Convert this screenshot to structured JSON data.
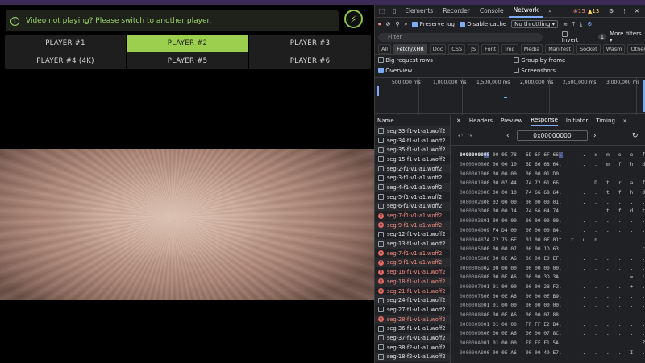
{
  "notice": {
    "text": "Video not playing? Please switch to another player.",
    "icon": "info-icon"
  },
  "players": [
    "PLAYER #1",
    "PLAYER #2",
    "PLAYER #3",
    "PLAYER #4 (4K)",
    "PLAYER #5",
    "PLAYER #6"
  ],
  "active_player": 1,
  "devtools": {
    "tabs": [
      "Elements",
      "Recorder",
      "Console",
      "Network"
    ],
    "active_tab": "Network",
    "errors": "15",
    "warnings": "13",
    "preserve_log": "Preserve log",
    "disable_cache": "Disable cache",
    "throttling": "No throttling",
    "filter_placeholder": "Filter",
    "invert": "Invert",
    "more_filters": "More filters",
    "more_filters_count": "1",
    "types": [
      "All",
      "Fetch/XHR",
      "Doc",
      "CSS",
      "JS",
      "Font",
      "Img",
      "Media",
      "Manifest",
      "Socket",
      "Wasm",
      "Other"
    ],
    "active_type": "Fetch/XHR",
    "opts": {
      "big": "Big request rows",
      "group": "Group by frame",
      "overview": "Overview",
      "screenshots": "Screenshots"
    },
    "timeline": [
      "500,000 ms",
      "1,000,000 ms",
      "1,500,000 ms",
      "2,000,000 ms",
      "2,500,000 ms",
      "3,000,000 ms"
    ],
    "name_header": "Name",
    "detail_tabs": [
      "Headers",
      "Preview",
      "Response",
      "Initiator",
      "Timing"
    ],
    "active_detail": "Response",
    "offset": "0x00000000",
    "requests": [
      {
        "n": "seg-33-f1-v1-a1.woff2",
        "e": false
      },
      {
        "n": "seg-34-f1-v1-a1.woff2",
        "e": false
      },
      {
        "n": "seg-35-f1-v1-a1.woff2",
        "e": false
      },
      {
        "n": "seg-15-f1-v1-a1.woff2",
        "e": false
      },
      {
        "n": "seg-2-f1-v1-a1.woff2",
        "e": false
      },
      {
        "n": "seg-3-f1-v1-a1.woff2",
        "e": false
      },
      {
        "n": "seg-4-f1-v1-a1.woff2",
        "e": false
      },
      {
        "n": "seg-5-f1-v1-a1.woff2",
        "e": false
      },
      {
        "n": "seg-6-f1-v1-a1.woff2",
        "e": false
      },
      {
        "n": "seg-7-f1-v1-a1.woff2",
        "e": true
      },
      {
        "n": "seg-9-f1-v1-a1.woff2",
        "e": true
      },
      {
        "n": "seg-12-f1-v1-a1.woff2",
        "e": false
      },
      {
        "n": "seg-13-f1-v1-a1.woff2",
        "e": false
      },
      {
        "n": "seg-7-f1-v1-a1.woff2",
        "e": true
      },
      {
        "n": "seg-9-f1-v1-a1.woff2",
        "e": true
      },
      {
        "n": "seg-16-f1-v1-a1.woff2",
        "e": true
      },
      {
        "n": "seg-18-f1-v1-a1.woff2",
        "e": true
      },
      {
        "n": "seg-21-f1-v1-a1.woff2",
        "e": true
      },
      {
        "n": "seg-24-f1-v1-a1.woff2",
        "e": false
      },
      {
        "n": "seg-27-f1-v1-a1.woff2",
        "e": false
      },
      {
        "n": "seg-28-f1-v1-a1.woff2",
        "e": true
      },
      {
        "n": "seg-36-f1-v1-a1.woff2",
        "e": false
      },
      {
        "n": "seg-37-f1-v1-a1.woff2",
        "e": false
      },
      {
        "n": "seg-38-f2-v1-a1.woff2",
        "e": false
      },
      {
        "n": "seg-18-f2-v1-a1.woff2",
        "e": false
      }
    ],
    "hex": [
      [
        "00000000",
        "00 00 0E 78   6D 6F 6F 66",
        ".  .  .  x  m  o  o  f"
      ],
      [
        "00000008",
        "00 00 00 10   6D 66 68 64",
        ".  .  .  .  m  f  h  d"
      ],
      [
        "00000010",
        "00 00 00 00   00 00 01 D0",
        ".  .  .  .  .  .  .  ."
      ],
      [
        "00000018",
        "00 00 07 44   74 72 61 66",
        ".  .  .  D  t  r  a  f"
      ],
      [
        "00000020",
        "00 00 00 10   74 66 68 64",
        ".  .  .  .  t  f  h  d"
      ],
      [
        "00000028",
        "00 02 00 00   00 00 00 01",
        ".  .  .  .  .  .  .  ."
      ],
      [
        "00000030",
        "00 00 00 14   74 66 64 74",
        ".  .  .  .  t  f  d  t"
      ],
      [
        "00000038",
        "01 00 00 00   00 00 00 00",
        ".  .  .  .  .  .  .  ."
      ],
      [
        "00000040",
        "09 F4 D4 00   00 00 00 84",
        ".  .  .  .  .  .  .  ."
      ],
      [
        "00000048",
        "74 72 75 6E   01 00 0F 01",
        "t  r  u  n  .  .  .  ."
      ],
      [
        "00000050",
        "00 00 00 07   00 00 1D 63",
        ".  .  .  .  .  .  .  c"
      ],
      [
        "00000058",
        "00 00 0E A6   00 00 E0 EF",
        ".  .  .  .  .  .  .  ."
      ],
      [
        "00000060",
        "02 00 00 00   00 00 00 00",
        ".  .  .  .  .  .  .  ."
      ],
      [
        "00000068",
        "00 00 0E A6   00 00 3D 3A",
        ".  .  .  .  .  .  =  :"
      ],
      [
        "00000070",
        "01 01 00 00   00 00 2B F2",
        ".  .  .  .  .  .  +  ."
      ],
      [
        "00000078",
        "00 00 0E A6   00 00 0E B9",
        ".  .  .  .  .  .  .  ."
      ],
      [
        "00000080",
        "01 01 00 00   00 00 00 00",
        ".  .  .  .  .  .  .  ."
      ],
      [
        "00000088",
        "00 00 0E A6   00 00 07 88",
        ".  .  .  .  .  .  .  ."
      ],
      [
        "00000090",
        "01 01 00 00   FF FF E2 B4",
        ".  .  .  .  .  .  .  ."
      ],
      [
        "00000098",
        "00 00 0E A6   00 00 07 8C",
        ".  .  .  .  .  .  .  ."
      ],
      [
        "000000A0",
        "01 01 00 00   FF FF F1 5A",
        ".  .  .  .  .  .  .  Z"
      ],
      [
        "000000A8",
        "00 00 0E A6   00 00 49 E7",
        ".  .  .  .  .  .  I  ."
      ]
    ]
  }
}
